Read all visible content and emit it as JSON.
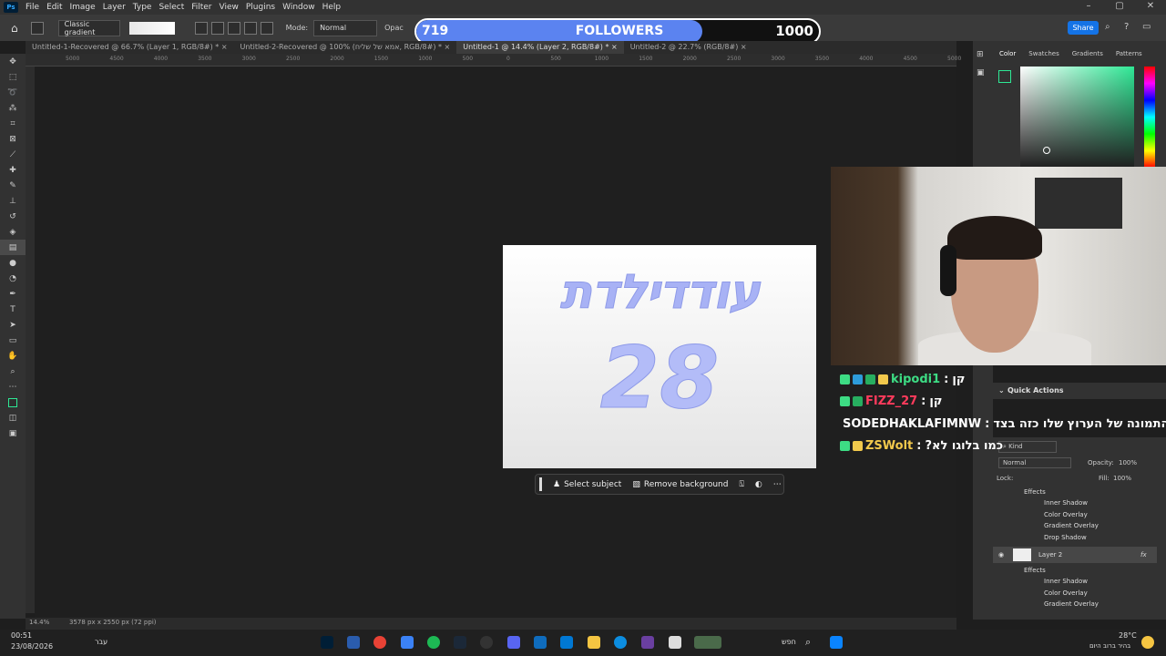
{
  "menu": {
    "app_logo": "Ps",
    "items": [
      "File",
      "Edit",
      "Image",
      "Layer",
      "Type",
      "Select",
      "Filter",
      "View",
      "Plugins",
      "Window",
      "Help"
    ]
  },
  "options": {
    "gradient_preset": "Classic gradient",
    "mode_label": "Mode:",
    "mode_value": "Normal",
    "opacity_label": "Opac",
    "share_label": "Share"
  },
  "followers": {
    "current": "719",
    "label": "FOLLOWERS",
    "goal": "1000",
    "progress": 0.719,
    "fill_color": "#5b83f0"
  },
  "tabs": [
    "Untitled-1-Recovered @ 66.7% (Layer 1, RGB/8#) * ×",
    "Untitled-2-Recovered @ 100% (אמא של שליח, RGB/8#) * ×",
    "Untitled-1 @ 14.4% (Layer 2, RGB/8#) * ×",
    "Untitled-2 @ 22.7% (RGB/8#) ×"
  ],
  "ruler_ticks": [
    "5000",
    "4500",
    "4000",
    "3500",
    "3000",
    "2500",
    "2000",
    "1500",
    "1000",
    "500",
    "0",
    "500",
    "1000",
    "1500",
    "2000",
    "2500",
    "3000",
    "3500",
    "4000",
    "4500",
    "5000"
  ],
  "document": {
    "hebrew_title": "עודדילדת",
    "number": "28",
    "text_color": "#a8b2f5"
  },
  "context_bar": {
    "select_subject": "Select subject",
    "remove_background": "Remove background"
  },
  "status": {
    "zoom": "14.4%",
    "dimensions": "3578 px x 2550 px (72 ppi)"
  },
  "color_panel": {
    "tabs": [
      "Color",
      "Swatches",
      "Gradients",
      "Patterns"
    ],
    "picker_hue": "#2ee895"
  },
  "chat": [
    {
      "user": "kipodi1",
      "user_color": "#3ddc84",
      "text": "קן",
      "badges": [
        "#3ddc84",
        "#2d9cdb",
        "#27ae60",
        "#f2c94c"
      ]
    },
    {
      "user": "FIZZ_27",
      "user_color": "#ff3b5c",
      "text": "קן",
      "badges": [
        "#3ddc84",
        "#27ae60"
      ]
    },
    {
      "user": "SODEDHAKLAFIMNW",
      "user_color": "#ffffff",
      "text": "ת התמונה של הערוץ שלו כזה בצד",
      "badges": [
        "#3ddc84"
      ]
    },
    {
      "user": "ZSWolt",
      "user_color": "#f2c94c",
      "text": "?כמו בלוגו לא",
      "badges": [
        "#3ddc84",
        "#f2c94c"
      ]
    }
  ],
  "quick_actions": "Quick Actions",
  "layers": {
    "filter": "Kind",
    "blend": "Normal",
    "opacity_label": "Opacity:",
    "opacity": "100%",
    "lock_label": "Lock:",
    "fill_label": "Fill:",
    "fill": "100%",
    "rows_top": [
      "Effects",
      "Inner Shadow",
      "Color Overlay",
      "Gradient Overlay",
      "Drop Shadow"
    ],
    "layer_name": "Layer 2",
    "rows_bottom": [
      "Effects",
      "Inner Shadow",
      "Color Overlay",
      "Gradient Overlay"
    ]
  },
  "taskbar": {
    "time": "00:51",
    "date": "23/08/2026",
    "lang": "עבר",
    "search": "חפש",
    "temp": "28°C",
    "weather": "בהיר ברוב היום"
  }
}
